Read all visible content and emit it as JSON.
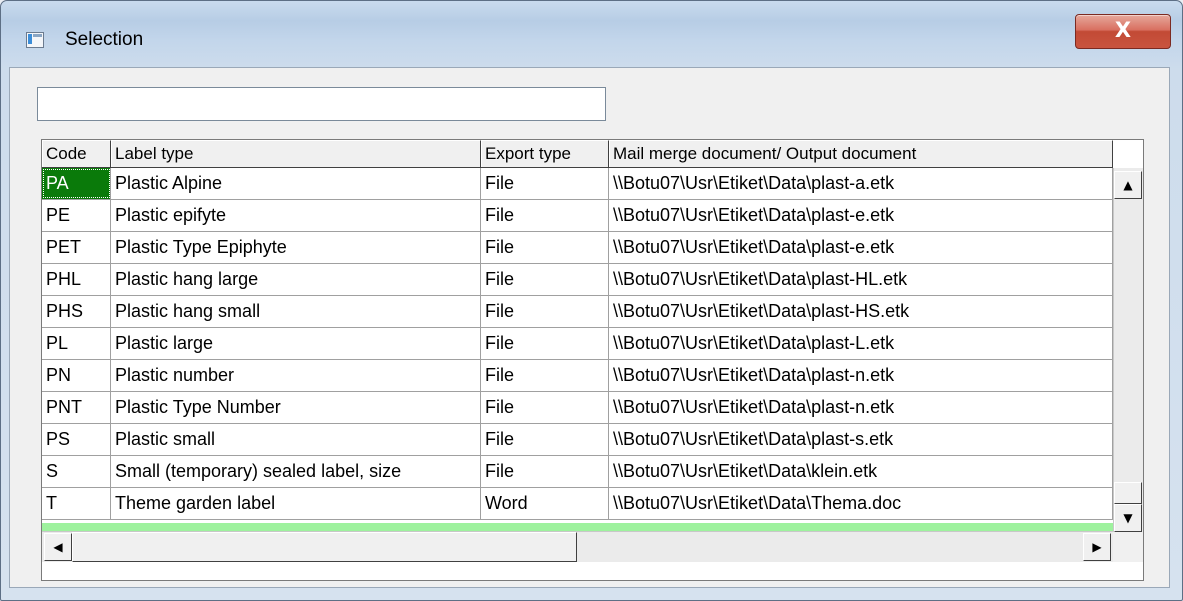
{
  "window": {
    "title": "Selection",
    "close_glyph": "X"
  },
  "search": {
    "value": ""
  },
  "grid": {
    "columns": [
      "Code",
      "Label type",
      "Export type",
      "Mail merge document/ Output document"
    ],
    "rows": [
      [
        "PA",
        "Plastic Alpine",
        "File",
        "\\\\Botu07\\Usr\\Etiket\\Data\\plast-a.etk"
      ],
      [
        "PE",
        "Plastic epifyte",
        "File",
        "\\\\Botu07\\Usr\\Etiket\\Data\\plast-e.etk"
      ],
      [
        "PET",
        "Plastic Type Epiphyte",
        "File",
        "\\\\Botu07\\Usr\\Etiket\\Data\\plast-e.etk"
      ],
      [
        "PHL",
        "Plastic hang large",
        "File",
        "\\\\Botu07\\Usr\\Etiket\\Data\\plast-HL.etk"
      ],
      [
        "PHS",
        "Plastic hang small",
        "File",
        "\\\\Botu07\\Usr\\Etiket\\Data\\plast-HS.etk"
      ],
      [
        "PL",
        "Plastic large",
        "File",
        "\\\\Botu07\\Usr\\Etiket\\Data\\plast-L.etk"
      ],
      [
        "PN",
        "Plastic number",
        "File",
        "\\\\Botu07\\Usr\\Etiket\\Data\\plast-n.etk"
      ],
      [
        "PNT",
        "Plastic Type Number",
        "File",
        "\\\\Botu07\\Usr\\Etiket\\Data\\plast-n.etk"
      ],
      [
        "PS",
        "Plastic small",
        "File",
        "\\\\Botu07\\Usr\\Etiket\\Data\\plast-s.etk"
      ],
      [
        "S",
        "Small (temporary) sealed label, size",
        "File",
        "\\\\Botu07\\Usr\\Etiket\\Data\\klein.etk"
      ],
      [
        "T",
        "Theme garden  label",
        "Word",
        "\\\\Botu07\\Usr\\Etiket\\Data\\Thema.doc"
      ]
    ],
    "selected_row": 0,
    "selected_color": "#0a7a0a",
    "new_row_color": "#9ef29e"
  },
  "scrollbars": {
    "up_arrow": "▲",
    "down_arrow": "▼",
    "left_arrow": "◀",
    "right_arrow": "▶"
  }
}
